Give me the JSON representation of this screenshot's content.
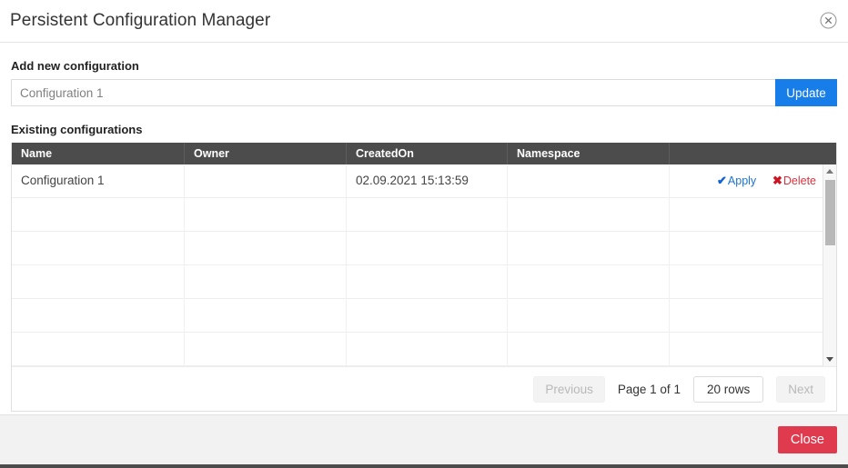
{
  "dialog": {
    "title": "Persistent Configuration Manager",
    "close_icon": "close-circle-icon"
  },
  "add_section": {
    "label": "Add new configuration",
    "input_value": "",
    "input_placeholder": "Configuration 1",
    "update_label": "Update"
  },
  "existing_section": {
    "label": "Existing configurations"
  },
  "table": {
    "columns": [
      "Name",
      "Owner",
      "CreatedOn",
      "Namespace",
      ""
    ],
    "rows": [
      {
        "name": "Configuration 1",
        "owner": "",
        "created_on": "02.09.2021 15:13:59",
        "namespace": "",
        "apply_label": "Apply",
        "delete_label": "Delete",
        "apply_icon": "check-icon",
        "delete_icon": "x-icon"
      },
      {
        "name": "",
        "owner": "",
        "created_on": "",
        "namespace": ""
      },
      {
        "name": "",
        "owner": "",
        "created_on": "",
        "namespace": ""
      },
      {
        "name": "",
        "owner": "",
        "created_on": "",
        "namespace": ""
      },
      {
        "name": "",
        "owner": "",
        "created_on": "",
        "namespace": ""
      },
      {
        "name": "",
        "owner": "",
        "created_on": "",
        "namespace": ""
      }
    ]
  },
  "pagination": {
    "previous_label": "Previous",
    "page_label": "Page 1 of 1",
    "rows_per_page": "20 rows",
    "next_label": "Next"
  },
  "footer": {
    "close_label": "Close"
  },
  "colors": {
    "update_blue": "#177de8",
    "close_red": "#e03a4e",
    "header_gray": "#4c4c4c",
    "apply_blue": "#1b74d4",
    "delete_red": "#d9333f"
  }
}
